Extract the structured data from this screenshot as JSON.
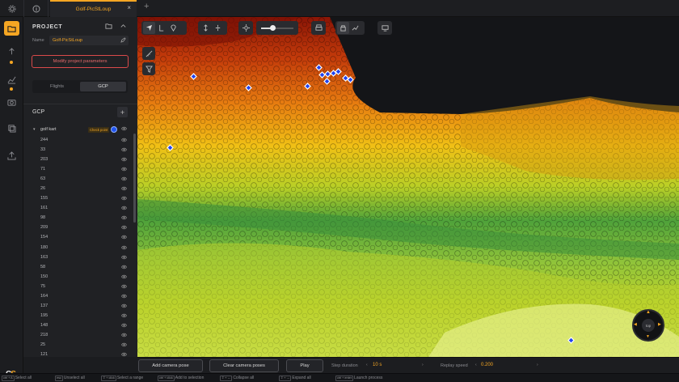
{
  "tab": {
    "title": "Golf-PicStLoup",
    "close": "×",
    "add": "+"
  },
  "rail": {
    "icons": [
      "folder-icon",
      "joystick-icon",
      "chart-icon",
      "camera-icon",
      "layers-icon",
      "export-icon"
    ],
    "logo_c": "C",
    "logo_s": "S"
  },
  "project": {
    "title": "PROJECT",
    "name_label": "Name",
    "name_value": "Golf-PicStLoup",
    "modify_label": "Modify project parameters",
    "seg_flights": "Flights",
    "seg_gcp": "GCP"
  },
  "gcp": {
    "title": "GCP",
    "add": "+",
    "group_name": "golf kart",
    "group_caret": "▾",
    "checkpoint_badge": "Check point",
    "points": [
      "244",
      "33",
      "203",
      "71",
      "63",
      "26",
      "155",
      "161",
      "98",
      "209",
      "154",
      "180",
      "163",
      "58",
      "150",
      "75",
      "164",
      "137",
      "195",
      "148",
      "218",
      "25",
      "121"
    ]
  },
  "bottom": {
    "add_pose": "Add camera pose",
    "clear_poses": "Clear camera poses",
    "play": "Play",
    "step_label": "Step duration",
    "step_value": "10 s",
    "speed_label": "Replay speed",
    "speed_value": "0.200",
    "arrow_left": "‹",
    "arrow_right": "›"
  },
  "compass": {
    "label": "top"
  },
  "shortcuts": [
    {
      "keys": "ctrl + A",
      "label": "Select all"
    },
    {
      "keys": "esc",
      "label": "Unselect all"
    },
    {
      "keys": "⇧ + click",
      "label": "Select a range"
    },
    {
      "keys": "ctrl + click",
      "label": "Add to selection"
    },
    {
      "keys": "⇧ + ←",
      "label": "Collapse all"
    },
    {
      "keys": "⇧ + →",
      "label": "Expand all"
    },
    {
      "keys": "ctrl + enter",
      "label": "Launch process"
    }
  ],
  "colors": {
    "accent": "#f5a623",
    "danger": "#d94a4a",
    "gcp_marker": "#2255ee"
  }
}
